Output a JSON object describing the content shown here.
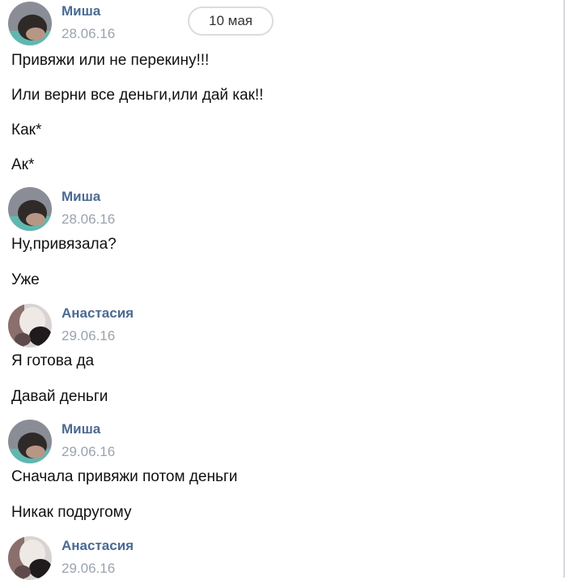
{
  "date_separator": "10 мая",
  "groups": [
    {
      "author": "Миша",
      "time": "28.06.16",
      "avatar": "misha-avatar",
      "messages": [
        "Привяжи или не перекину!!!",
        "Или верни все деньги,или дай как!!",
        "Как*",
        "Ак*"
      ]
    },
    {
      "author": "Миша",
      "time": "28.06.16",
      "avatar": "misha-avatar",
      "messages": [
        "Ну,привязала?",
        "Уже"
      ]
    },
    {
      "author": "Анастасия",
      "time": "29.06.16",
      "avatar": "anastasia-avatar",
      "messages": [
        "Я готова да",
        "Давай деньги"
      ]
    },
    {
      "author": "Миша",
      "time": "29.06.16",
      "avatar": "misha-avatar",
      "messages": [
        "Сначала привяжи потом деньги",
        "Никак подругому"
      ]
    },
    {
      "author": "Анастасия",
      "time": "29.06.16",
      "avatar": "anastasia-avatar",
      "messages": []
    }
  ],
  "colors": {
    "author_name": "#4a6a93",
    "timestamp": "#9aa3ad",
    "pill_border": "#d8dce1"
  }
}
